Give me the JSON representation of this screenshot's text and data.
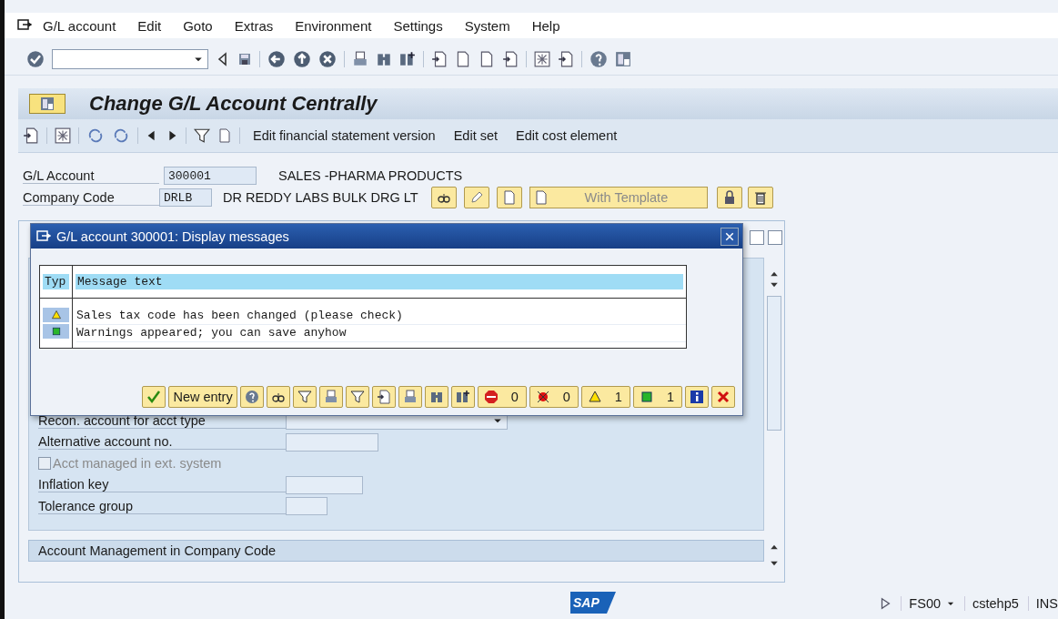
{
  "menu_bar": {
    "items": [
      "G/L account",
      "Edit",
      "Goto",
      "Extras",
      "Environment",
      "Settings",
      "System",
      "Help"
    ]
  },
  "title": "Change G/L Account Centrally",
  "app_toolbar": {
    "buttons": [
      "Edit financial statement version",
      "Edit set",
      "Edit cost element"
    ]
  },
  "header_fields": [
    {
      "label": "G/L Account",
      "value": "300001",
      "description": "SALES -PHARMA PRODUCTS"
    },
    {
      "label": "Company Code",
      "value": "DRLB",
      "description": "DR REDDY LABS BULK DRG LT"
    }
  ],
  "template_button": {
    "label": "With Template",
    "disabled": true
  },
  "form": {
    "fields": [
      {
        "kind": "dropdown",
        "label": "Recon. account for acct type"
      },
      {
        "kind": "input",
        "label": "Alternative account no."
      },
      {
        "kind": "checkbox",
        "label": "Acct managed in ext. system",
        "checked": false,
        "disabled": true
      },
      {
        "kind": "input",
        "label": "Inflation key"
      },
      {
        "kind": "input",
        "label": "Tolerance group"
      }
    ]
  },
  "section_header": "Account Management in Company Code",
  "dialog": {
    "title": "G/L account 300001: Display messages",
    "columns": [
      "Typ",
      "Message text"
    ],
    "messages": [
      {
        "kind": "warning",
        "text": "Sales tax code has been changed (please check)"
      },
      {
        "kind": "success",
        "text": "Warnings appeared; you can save anyhow"
      }
    ],
    "new_entry_label": "New entry",
    "counters": [
      {
        "kind": "stop",
        "count": "0"
      },
      {
        "kind": "error",
        "count": "0"
      },
      {
        "kind": "warning",
        "count": "1"
      },
      {
        "kind": "success",
        "count": "1"
      }
    ]
  },
  "logo": "SAP",
  "status_bar": {
    "transaction": "FS00",
    "server": "cstehp5",
    "mode": "INS"
  }
}
